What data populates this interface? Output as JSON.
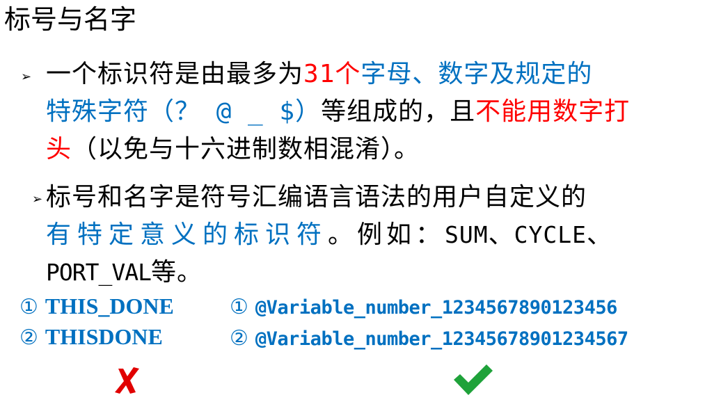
{
  "slide": {
    "title": "标号与名字",
    "bullet1": {
      "marker": "➢",
      "line1": {
        "a": "一个标识符是由最多为",
        "b": "31个",
        "c": "字母、数字及规定的"
      },
      "line2": {
        "a": "特殊字符（",
        "b": "？ @ _ $",
        "c": "）",
        "d": "等组成的，且",
        "e": "不能用数字打"
      },
      "line3": {
        "a": "头",
        "b": "（以免与十六进制数相混淆）。"
      }
    },
    "bullet2": {
      "marker": "➢",
      "line1": "标号和名字是符号汇编语言语法的用户自定义的",
      "line2": {
        "a": "有特定意义的标识符",
        "b": "。例如：",
        "c": "SUM",
        "d": "、",
        "e": "CYCLE",
        "f": "、"
      },
      "line3": {
        "a": "PORT_VAL",
        "b": "等。"
      }
    },
    "invalid_examples": [
      {
        "num": "①",
        "text": "THIS_DONE"
      },
      {
        "num": "②",
        "text": "THISDONE"
      }
    ],
    "valid_examples": [
      {
        "num": "①",
        "text": "@Variable_number_1234567890123456"
      },
      {
        "num": "②",
        "text": "@Variable_number_12345678901234567"
      }
    ],
    "icons": {
      "wrong": "cross-mark-icon",
      "right": "check-mark-icon"
    },
    "colors": {
      "text": "#000000",
      "highlight_red": "#ff0000",
      "highlight_blue": "#0070c0",
      "wrong_mark": "#e10000",
      "right_mark": "#1fa23a"
    }
  }
}
